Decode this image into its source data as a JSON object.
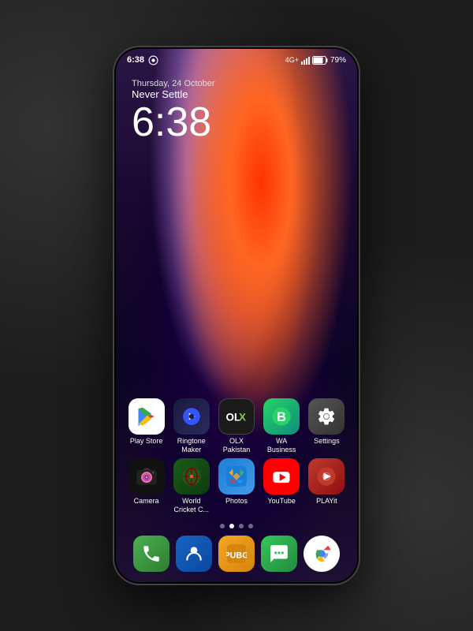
{
  "phone": {
    "status_bar": {
      "time": "6:38",
      "battery_percent": "79%",
      "signal": "4G+"
    },
    "datetime": {
      "date": "Thursday, 24 October",
      "motto": "Never Settle",
      "time": "6:38"
    },
    "app_rows": [
      [
        {
          "id": "play-store",
          "label": "Play Store",
          "icon_type": "play-store"
        },
        {
          "id": "ringtone-maker",
          "label": "Ringtone Maker",
          "icon_type": "ringtone"
        },
        {
          "id": "olx-pakistan",
          "label": "OLX Pakistan",
          "icon_type": "olx"
        },
        {
          "id": "wa-business",
          "label": "WA Business",
          "icon_type": "wa-business"
        },
        {
          "id": "settings",
          "label": "Settings",
          "icon_type": "settings"
        }
      ],
      [
        {
          "id": "camera",
          "label": "Camera",
          "icon_type": "camera"
        },
        {
          "id": "wcc",
          "label": "World Cricket C...",
          "icon_type": "wcc"
        },
        {
          "id": "photos",
          "label": "Photos",
          "icon_type": "photos"
        },
        {
          "id": "youtube",
          "label": "YouTube",
          "icon_type": "youtube"
        },
        {
          "id": "playit",
          "label": "PLAYit",
          "icon_type": "playit"
        }
      ]
    ],
    "page_dots": [
      {
        "active": false
      },
      {
        "active": true
      },
      {
        "active": false
      },
      {
        "active": false
      }
    ],
    "dock": [
      {
        "id": "phone",
        "icon_type": "phone"
      },
      {
        "id": "contacts",
        "icon_type": "contacts"
      },
      {
        "id": "pubg",
        "icon_type": "pubg"
      },
      {
        "id": "messages",
        "icon_type": "messages"
      },
      {
        "id": "chrome",
        "icon_type": "chrome"
      }
    ]
  }
}
